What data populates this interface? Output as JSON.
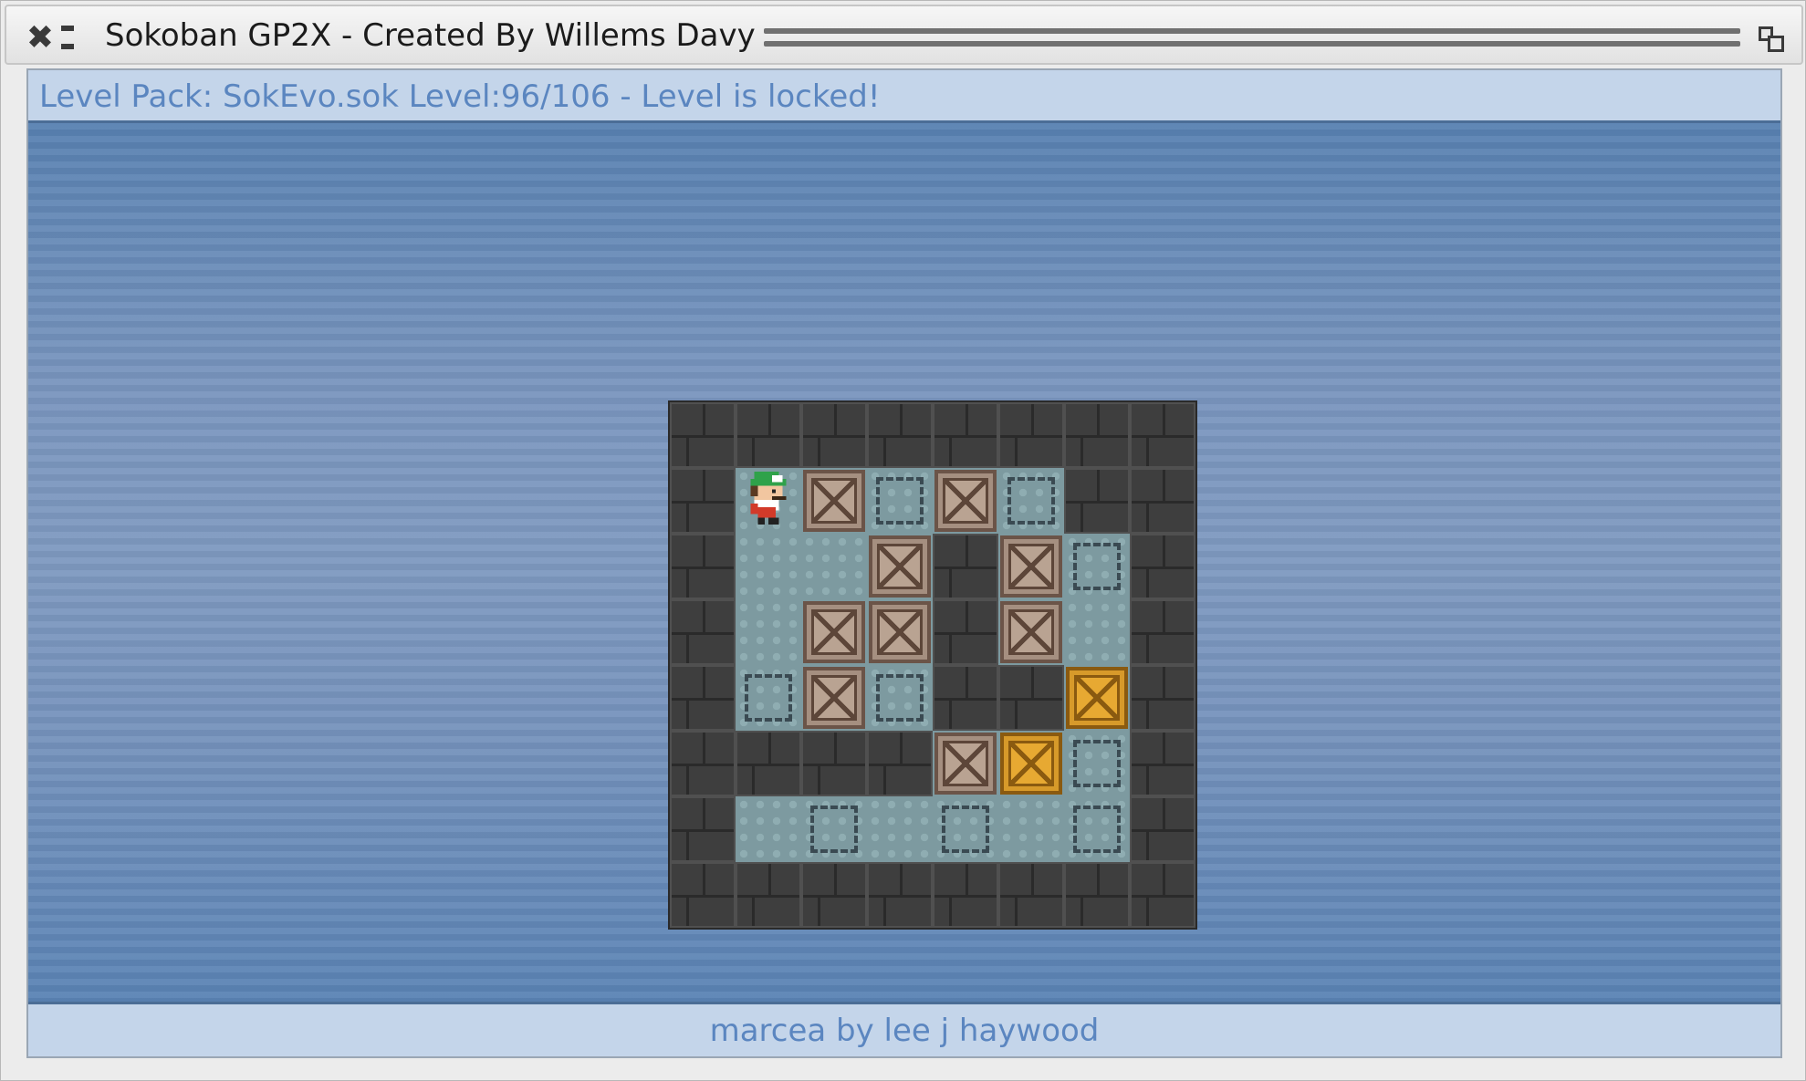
{
  "window": {
    "title": "Sokoban GP2X - Created By Willems Davy",
    "close_icon": "close-icon",
    "shade_icon": "shade-icon",
    "maximize_icon": "maximize-icon"
  },
  "status": {
    "text": "Level Pack: SokEvo.sok Level:96/106 - Level is locked!"
  },
  "footer": {
    "text": "marcea by lee j haywood"
  },
  "level": {
    "pack": "SokEvo.sok",
    "current": 96,
    "total": 106,
    "locked": true,
    "legend": {
      "#": "wall",
      " ": "floor",
      ".": "goal",
      "$": "box",
      "*": "box-on-goal",
      "@": "player",
      "+": "player-on-goal"
    },
    "map": [
      "########",
      "#@$.$.##",
      "#  $#$.#",
      "# $$#$ #",
      "#.$.##*#",
      "####$*.#",
      "# . . .#",
      "########"
    ],
    "colors": {
      "wall": "#3e3e3e",
      "floor": "#7d9aa0",
      "box": "#a58f80",
      "box_on_goal": "#d79a2a",
      "background": "#7592bc"
    }
  }
}
